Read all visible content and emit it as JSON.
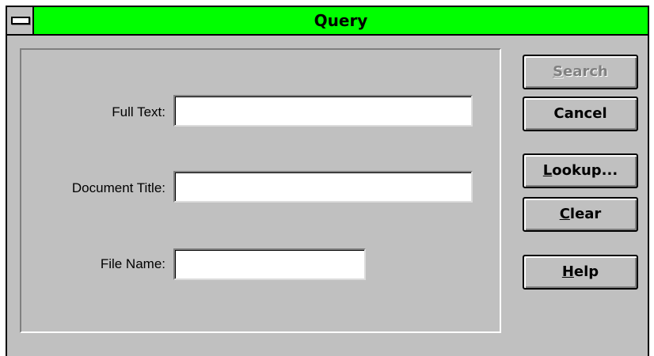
{
  "window": {
    "title": "Query",
    "title_bar_color": "#00ff00",
    "system_menu_icon": "system-menu-icon"
  },
  "form": {
    "full_text_label": "Full Text:",
    "full_text_value": "",
    "document_title_label": "Document Title:",
    "document_title_value": "",
    "file_name_label": "File Name:",
    "file_name_value": ""
  },
  "buttons": {
    "search": {
      "mnemonic": "S",
      "rest": "earch",
      "enabled": false
    },
    "cancel": {
      "label": "Cancel"
    },
    "lookup": {
      "mnemonic": "L",
      "rest": "ookup..."
    },
    "clear": {
      "mnemonic": "C",
      "rest": "lear"
    },
    "help": {
      "mnemonic": "H",
      "rest": "elp"
    }
  }
}
